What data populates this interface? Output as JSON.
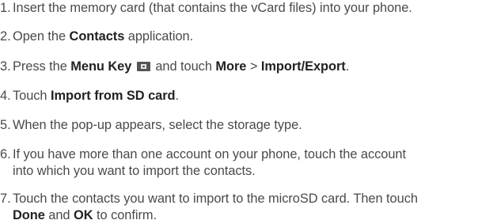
{
  "steps": [
    {
      "num": "1.",
      "lines": [
        [
          {
            "t": "Insert the memory card (that contains the vCard files) into your phone."
          }
        ]
      ]
    },
    {
      "num": "2.",
      "lines": [
        [
          {
            "t": "Open the "
          },
          {
            "t": "Contacts",
            "b": true
          },
          {
            "t": " application."
          }
        ]
      ]
    },
    {
      "num": "3.",
      "lines": [
        [
          {
            "t": "Press the "
          },
          {
            "t": "Menu Key",
            "b": true
          },
          {
            "t": " "
          },
          {
            "icon": "menu-key-icon"
          },
          {
            "t": " and touch "
          },
          {
            "t": "More",
            "b": true
          },
          {
            "t": " > "
          },
          {
            "t": "Import/Export",
            "b": true
          },
          {
            "t": "."
          }
        ]
      ]
    },
    {
      "num": "4.",
      "lines": [
        [
          {
            "t": "Touch "
          },
          {
            "t": "Import from SD card",
            "b": true
          },
          {
            "t": "."
          }
        ]
      ]
    },
    {
      "num": "5.",
      "lines": [
        [
          {
            "t": "When the pop-up appears, select the storage type."
          }
        ]
      ]
    },
    {
      "num": "6.",
      "lines": [
        [
          {
            "t": "If you have more than one account on your phone, touch the account"
          }
        ],
        [
          {
            "t": "into which you want to import the contacts."
          }
        ]
      ]
    },
    {
      "num": "7.",
      "lines": [
        [
          {
            "t": "Touch the contacts you want to import to the microSD card. Then touch"
          }
        ],
        [
          {
            "t": "Done",
            "b": true
          },
          {
            "t": " and "
          },
          {
            "t": "OK",
            "b": true
          },
          {
            "t": " to confirm."
          }
        ]
      ]
    }
  ]
}
